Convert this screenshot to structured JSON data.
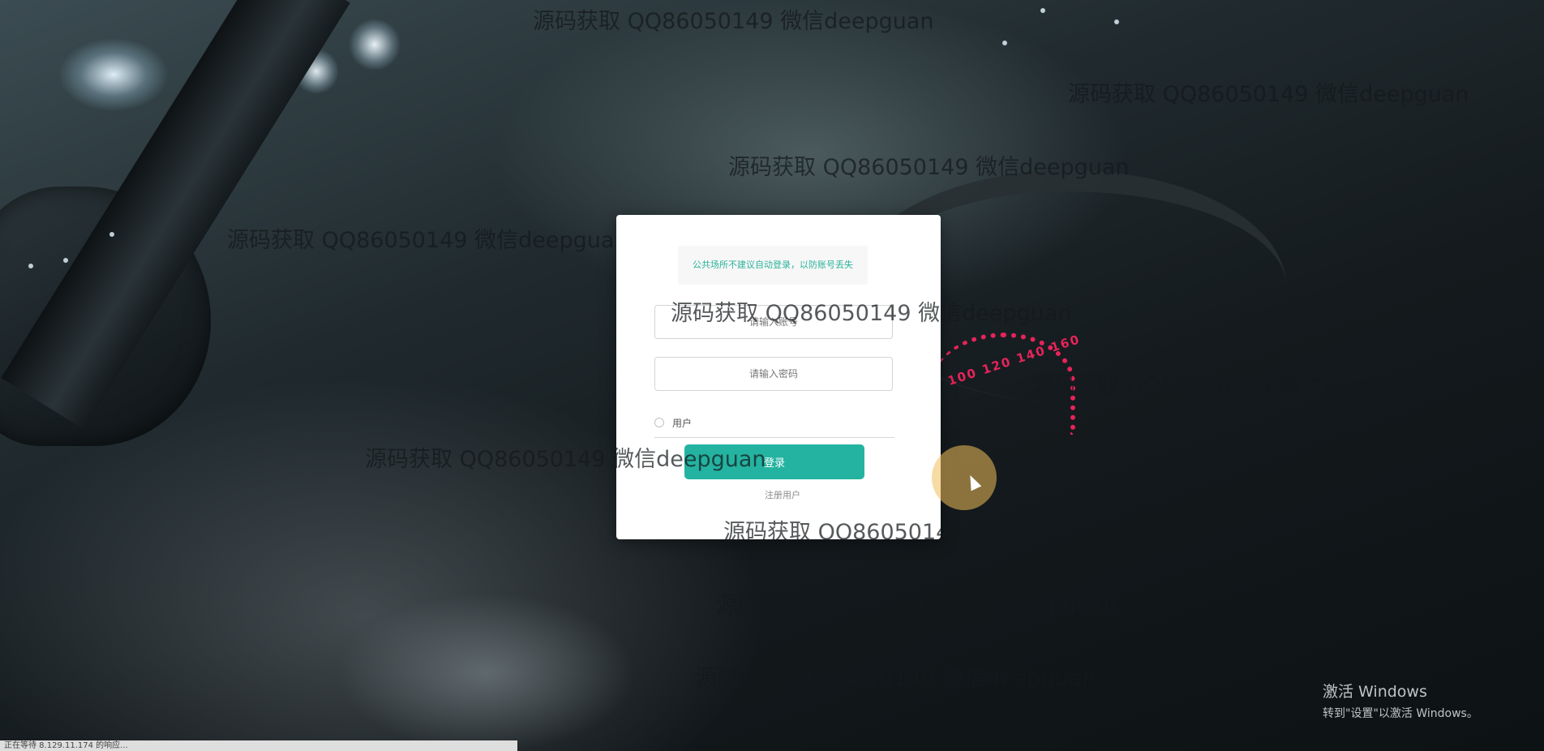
{
  "watermark_text": "源码获取 QQ86050149 微信deepguan",
  "login": {
    "notice": "公共场所不建议自动登录，以防账号丢失",
    "account_placeholder": "请输入账号",
    "password_placeholder": "请输入密码",
    "role_option": "用户",
    "login_button": "登录",
    "register_link": "注册用户"
  },
  "colors": {
    "accent": "#24b3a0",
    "notice_text": "#2bb39c"
  },
  "activation": {
    "title": "激活 Windows",
    "subtitle": "转到\"设置\"以激活 Windows。"
  },
  "statusbar": {
    "text": "正在等待 8.129.11.174 的响应..."
  }
}
